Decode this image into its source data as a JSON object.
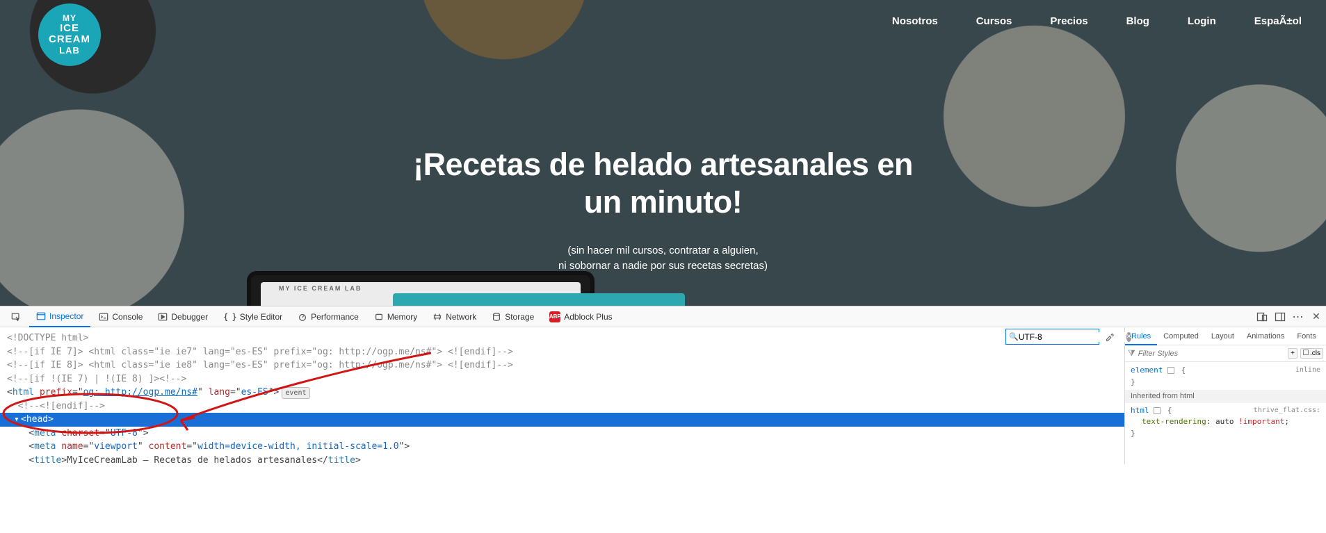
{
  "site": {
    "logo": {
      "l1": "MY",
      "l2": "ICE",
      "l3": "CREAM",
      "l4": "LAB"
    },
    "nav": [
      "Nosotros",
      "Cursos",
      "Precios",
      "Blog",
      "Login",
      "EspaÃ±ol"
    ],
    "hero_title_l1": "¡Recetas de helado artesanales en",
    "hero_title_l2": "un minuto!",
    "hero_sub_l1": "(sin hacer mil cursos, contratar a alguien,",
    "hero_sub_l2": "ni sobornar a nadie por sus recetas secretas)",
    "tablet_label": "MY ICE CREAM LAB"
  },
  "devtools": {
    "tabs": {
      "inspector": "Inspector",
      "console": "Console",
      "debugger": "Debugger",
      "style_editor": "Style Editor",
      "performance": "Performance",
      "memory": "Memory",
      "network": "Network",
      "storage": "Storage",
      "adblock": "Adblock Plus"
    },
    "search_value": "UTF-8",
    "html_lines": {
      "doctype": "<!DOCTYPE html>",
      "if_ie7": "<!--[if IE 7]> <html class=\"ie ie7\" lang=\"es-ES\" prefix=\"og: http://ogp.me/ns#\"> <![endif]-->",
      "if_ie8": "<!--[if IE 8]> <html class=\"ie ie8\" lang=\"es-ES\" prefix=\"og: http://ogp.me/ns#\"> <![endif]-->",
      "if_not_ie": "<!--[if !(IE 7) | !(IE 8) ]><!-->",
      "html_open_prefix": "og: http://ogp.me/ns#",
      "html_open_lang": "es-ES",
      "event_pill": "event",
      "endif": "<!--<![endif]-->",
      "head": "<head>",
      "meta_charset": "UTF-8",
      "meta_viewport": "width=device-width, initial-scale=1.0",
      "title_text": "MyIceCreamLab – Recetas de helados artesanales"
    },
    "rules": {
      "tabs": [
        "Rules",
        "Computed",
        "Layout",
        "Animations",
        "Fonts"
      ],
      "filter_placeholder": "Filter Styles",
      "cls_btn": ".cls",
      "add_btn": "+",
      "element_sel": "element",
      "open_brace": "{",
      "close_brace": "}",
      "inline_src": "inline",
      "inherited_label": "Inherited from html",
      "html_sel": "html",
      "thrive_src": "thrive_flat.css:",
      "prop1_name": "text-rendering",
      "prop1_val": "auto",
      "important": "!important",
      "semi": ";"
    }
  }
}
